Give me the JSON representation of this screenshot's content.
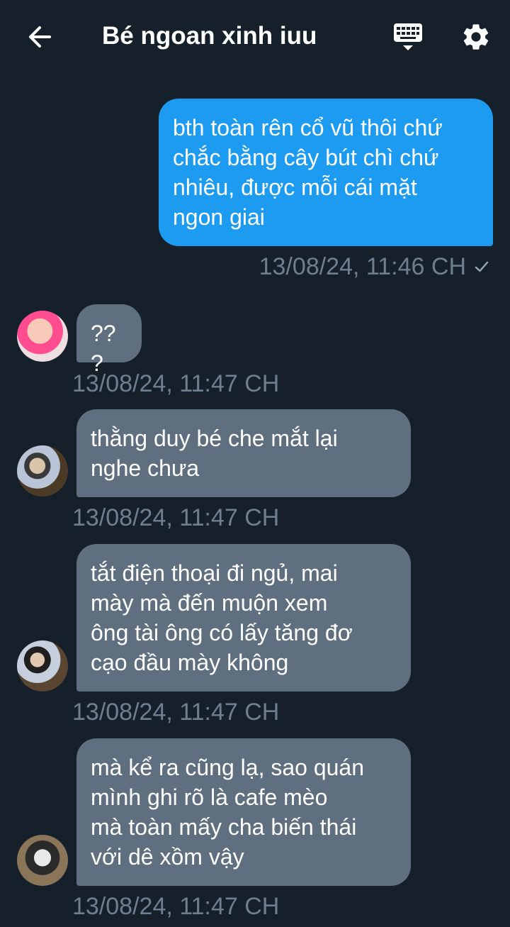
{
  "header": {
    "title": "Bé ngoan xinh iuu"
  },
  "icons": {
    "back": "arrow-left-icon",
    "keyboard": "keyboard-icon",
    "settings": "gear-icon"
  },
  "colors": {
    "background": "#15202b",
    "outgoing_bubble": "#1d9bf0",
    "incoming_bubble": "#5f6f7f",
    "timestamp": "#6e7f8f"
  },
  "messages": [
    {
      "direction": "outgoing",
      "text": "bth toàn rên cổ vũ thôi chứ\nchắc bằng cây bút chì chứ\nnhiêu, được mỗi cái mặt\nngon giai",
      "time": "13/08/24, 11:46 CH",
      "status": "sent"
    },
    {
      "direction": "incoming",
      "text": "???",
      "time": "13/08/24, 11:47 CH"
    },
    {
      "direction": "incoming",
      "text": "thằng duy bé che mắt lại\nnghe chưa",
      "time": "13/08/24, 11:47 CH"
    },
    {
      "direction": "incoming",
      "text": "tắt điện thoại đi ngủ, mai\nmày mà đến muộn xem\nông tài ông có lấy tăng đơ\ncạo đầu mày không",
      "time": "13/08/24, 11:47 CH"
    },
    {
      "direction": "incoming",
      "text": "mà kể ra cũng lạ, sao quán\nmình ghi rõ là cafe mèo\nmà toàn mấy cha biến thái\nvới dê xồm vậy",
      "time": "13/08/24, 11:47 CH"
    }
  ]
}
